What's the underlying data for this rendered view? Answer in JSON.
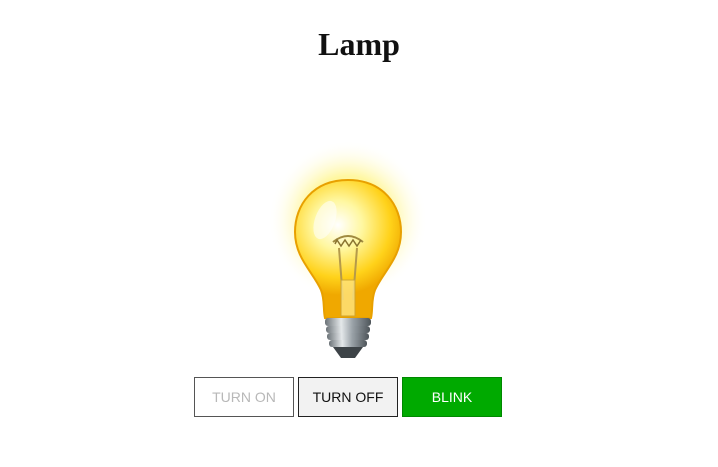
{
  "page": {
    "title": "Lamp"
  },
  "lamp": {
    "state": "on",
    "icon": "lightbulb-icon"
  },
  "controls": {
    "turn_on_label": "TURN ON",
    "turn_off_label": "TURN OFF",
    "blink_label": "BLINK"
  },
  "colors": {
    "blink_active": "#00aa00",
    "disabled_text": "#b8b8b8",
    "bulb_glow": "#ffe600"
  }
}
